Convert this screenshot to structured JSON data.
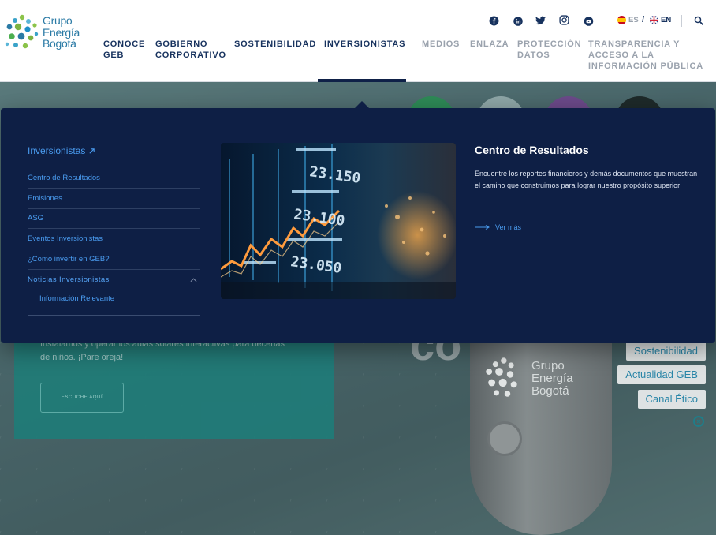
{
  "brand": {
    "name_lines": [
      "Grupo",
      "Energía",
      "Bogotá"
    ],
    "colors": {
      "navy": "#17325e",
      "menu_bg": "#0e1f45",
      "link_blue": "#4a9cf0",
      "teal": "#207c78"
    }
  },
  "header": {
    "nav": [
      {
        "label_line1": "CONOCE",
        "label_line2": "GEB"
      },
      {
        "label_line1": "GOBIERNO",
        "label_line2": "CORPORATIVO"
      },
      {
        "label_line1": "SOSTENIBILIDAD",
        "label_line2": ""
      },
      {
        "label_line1": "INVERSIONISTAS",
        "label_line2": "",
        "active": true
      },
      {
        "label_line1": "MEDIOS",
        "label_line2": ""
      },
      {
        "label_line1": "ENLAZA",
        "label_line2": ""
      },
      {
        "label_line1": "PROTECCIÓN",
        "label_line2": "DATOS"
      },
      {
        "label_line1": "TRANSPARENCIA Y",
        "label_line2": "ACCESO A LA",
        "label_line3": "INFORMACIÓN PÚBLICA"
      }
    ],
    "social_icons": [
      "facebook-icon",
      "linkedin-icon",
      "twitter-icon",
      "instagram-icon",
      "youtube-icon"
    ],
    "languages": [
      {
        "code": "ES",
        "flag": "spain-flag-icon",
        "selected": false
      },
      {
        "separator": "/"
      },
      {
        "code": "EN",
        "flag": "uk-flag-icon",
        "selected": true
      }
    ],
    "search_icon": "search-icon"
  },
  "mega_menu": {
    "section_title": "Inversionistas",
    "links": [
      {
        "label": "Centro de Resultados"
      },
      {
        "label": "Emisiones"
      },
      {
        "label": "ASG"
      },
      {
        "label": "Eventos Inversionistas"
      },
      {
        "label": "¿Como invertir en GEB?"
      },
      {
        "label": "Noticias Inversionistas",
        "expanded": true
      }
    ],
    "sub_links": [
      {
        "label": "Información Relevante"
      }
    ],
    "featured": {
      "title": "Centro de Resultados",
      "description": "Encuentre los reportes financieros y demás documentos que muestran el camino que construimos para lograr nuestro propósito superior",
      "more_label": "Ver más"
    }
  },
  "hero": {
    "card_text": "Instalamos y operamos aulas solares interactivas para decenas de niños. ¡Pare oreja!",
    "card_button": "ESCUCHE AQUÍ",
    "side_tags": [
      "Sostenibilidad",
      "Actualidad GEB",
      "Canal Ético"
    ],
    "mic_logo_lines": [
      "Grupo",
      "Energía",
      "Bogotá"
    ]
  }
}
